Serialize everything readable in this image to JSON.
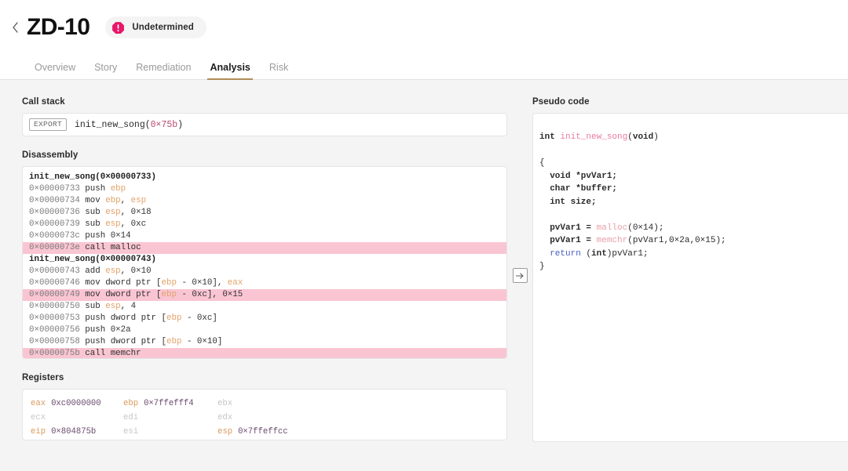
{
  "header": {
    "back_icon": "chevron-left-icon",
    "title": "ZD-10",
    "badge": {
      "icon": "alert-octagon-icon",
      "label": "Undetermined",
      "icon_color": "#e8176a",
      "bg_color": "#f4f4f4"
    }
  },
  "tabs": {
    "items": [
      {
        "label": "Overview",
        "active": false
      },
      {
        "label": "Story",
        "active": false
      },
      {
        "label": "Remediation",
        "active": false
      },
      {
        "label": "Analysis",
        "active": true
      },
      {
        "label": "Risk",
        "active": false
      }
    ],
    "active_underline_color": "#b08d57"
  },
  "call_stack": {
    "label": "Call stack",
    "entries": [
      {
        "tag": "EXPORT",
        "fn": "init_new_song(",
        "addr": "0×75b",
        "close": ")"
      }
    ]
  },
  "disassembly": {
    "label": "Disassembly",
    "highlight_color": "#fac5d2",
    "lines": [
      {
        "kind": "label",
        "text": "init_new_song(0×00000733)",
        "highlight": false
      },
      {
        "kind": "insn",
        "addr": "0×00000733",
        "mnemonic": "push",
        "operands": "ebp",
        "highlight": false
      },
      {
        "kind": "insn",
        "addr": "0×00000734",
        "mnemonic": "mov",
        "operands": "ebp, esp",
        "highlight": false
      },
      {
        "kind": "insn",
        "addr": "0×00000736",
        "mnemonic": "sub",
        "operands": "esp, 0×18",
        "highlight": false
      },
      {
        "kind": "insn",
        "addr": "0×00000739",
        "mnemonic": "sub",
        "operands": "esp, 0xc",
        "highlight": false
      },
      {
        "kind": "insn",
        "addr": "0×0000073c",
        "mnemonic": "push",
        "operands": "0×14",
        "highlight": false
      },
      {
        "kind": "insn",
        "addr": "0×0000073e",
        "mnemonic": "call",
        "operands": "malloc",
        "highlight": true
      },
      {
        "kind": "label",
        "text": "init_new_song(0×00000743)",
        "highlight": false
      },
      {
        "kind": "insn",
        "addr": "0×00000743",
        "mnemonic": "add",
        "operands": "esp, 0×10",
        "highlight": false
      },
      {
        "kind": "insn",
        "addr": "0×00000746",
        "mnemonic": "mov",
        "operands": "dword ptr [ebp - 0×10], eax",
        "highlight": false
      },
      {
        "kind": "insn",
        "addr": "0×00000749",
        "mnemonic": "mov",
        "operands": "dword ptr [ebp - 0xc], 0×15",
        "highlight": true
      },
      {
        "kind": "insn",
        "addr": "0×00000750",
        "mnemonic": "sub",
        "operands": "esp, 4",
        "highlight": false
      },
      {
        "kind": "insn",
        "addr": "0×00000753",
        "mnemonic": "push",
        "operands": "dword ptr [ebp - 0xc]",
        "highlight": false
      },
      {
        "kind": "insn",
        "addr": "0×00000756",
        "mnemonic": "push",
        "operands": "0×2a",
        "highlight": false
      },
      {
        "kind": "insn",
        "addr": "0×00000758",
        "mnemonic": "push",
        "operands": "dword ptr [ebp - 0×10]",
        "highlight": false
      },
      {
        "kind": "insn",
        "addr": "0×0000075b",
        "mnemonic": "call",
        "operands": "memchr",
        "highlight": true
      }
    ]
  },
  "registers": {
    "label": "Registers",
    "rows": [
      [
        {
          "name": "eax",
          "value": "0xc0000000",
          "active": true
        },
        {
          "name": "ebp",
          "value": "0×7ffefff4",
          "active": true
        },
        {
          "name": "ebx",
          "value": "",
          "active": false
        }
      ],
      [
        {
          "name": "ecx",
          "value": "",
          "active": false
        },
        {
          "name": "edi",
          "value": "",
          "active": false
        },
        {
          "name": "edx",
          "value": "",
          "active": false
        }
      ],
      [
        {
          "name": "eip",
          "value": "0×804875b",
          "active": true
        },
        {
          "name": "esi",
          "value": "",
          "active": false
        },
        {
          "name": "esp",
          "value": "0×7ffeffcc",
          "active": true
        }
      ]
    ]
  },
  "toggle": {
    "icon": "arrow-right-icon"
  },
  "pseudo_code": {
    "label": "Pseudo code",
    "lines": [
      [
        {
          "t": "int ",
          "c": "p-type"
        },
        {
          "t": "init_new_song",
          "c": "p-fn"
        },
        {
          "t": "(",
          "c": ""
        },
        {
          "t": "void",
          "c": "p-type"
        },
        {
          "t": ")",
          "c": ""
        }
      ],
      [
        {
          "t": "",
          "c": ""
        }
      ],
      [
        {
          "t": "{",
          "c": ""
        }
      ],
      [
        {
          "t": "  void *pvVar1;",
          "c": "p-type"
        }
      ],
      [
        {
          "t": "  char *buffer;",
          "c": "p-type"
        }
      ],
      [
        {
          "t": "  int size;",
          "c": "p-type"
        }
      ],
      [
        {
          "t": "",
          "c": ""
        }
      ],
      [
        {
          "t": "  pvVar1 = ",
          "c": "p-type"
        },
        {
          "t": "malloc",
          "c": "p-call"
        },
        {
          "t": "(0×14);",
          "c": "p-num"
        }
      ],
      [
        {
          "t": "  pvVar1 = ",
          "c": "p-type"
        },
        {
          "t": "memchr",
          "c": "p-call"
        },
        {
          "t": "(pvVar1,0×2a,0×15);",
          "c": "p-num"
        }
      ],
      [
        {
          "t": "  ",
          "c": ""
        },
        {
          "t": "return",
          "c": "p-kw"
        },
        {
          "t": " (",
          "c": ""
        },
        {
          "t": "int",
          "c": "p-type"
        },
        {
          "t": ")pvVar1;",
          "c": "p-num"
        }
      ],
      [
        {
          "t": "}",
          "c": ""
        }
      ]
    ]
  }
}
